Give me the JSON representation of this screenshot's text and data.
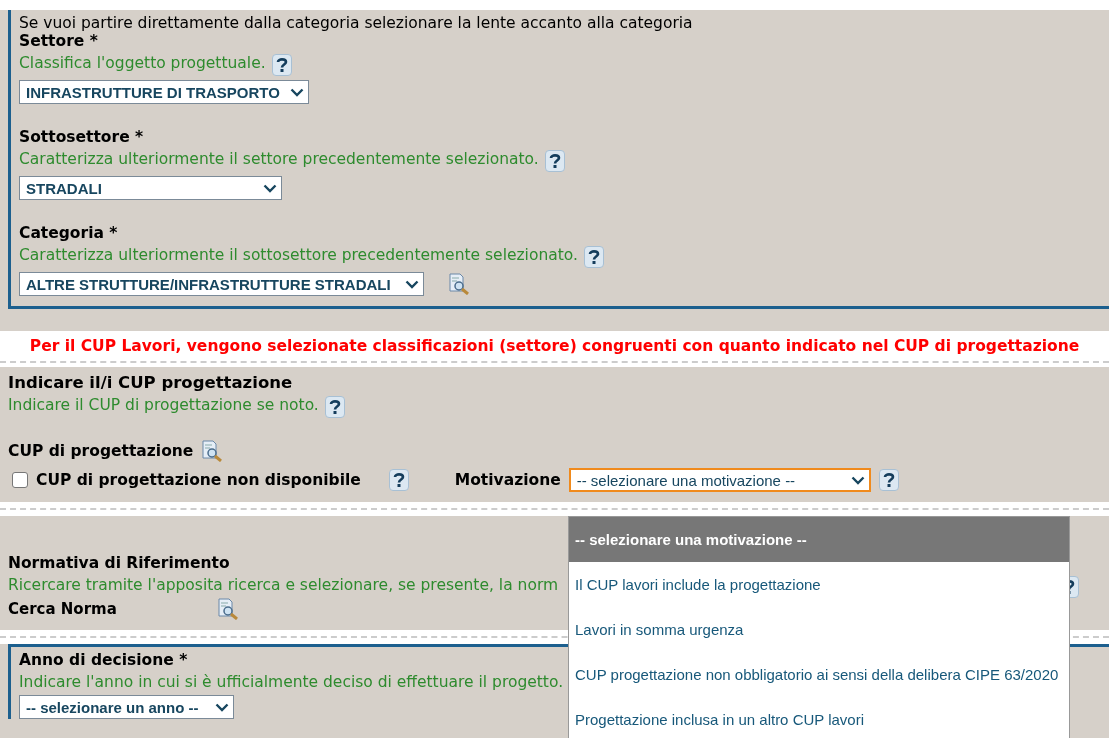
{
  "intro": "Se vuoi partire direttamente dalla categoria selezionare la lente accanto alla categoria",
  "classification_fields": [
    {
      "label": "Settore *",
      "hint": "Classifica l'oggetto progettuale.",
      "value": "INFRASTRUTTURE DI TRASPORTO",
      "search_icon": false
    },
    {
      "label": "Sottosettore *",
      "hint": "Caratterizza ulteriormente il settore precedentemente selezionato.",
      "value": "STRADALI",
      "search_icon": false
    },
    {
      "label": "Categoria *",
      "hint": "Caratterizza ulteriormente il sottosettore precedentemente selezionato.",
      "value": "ALTRE STRUTTURE/INFRASTRUTTURE STRADALI",
      "search_icon": true
    }
  ],
  "warning": "Per il CUP Lavori, vengono selezionate classificazioni (settore) congruenti con quanto indicato nel CUP di progettazione",
  "cup_section": {
    "heading": "Indicare il/i CUP progettazione",
    "hint": "Indicare il CUP di progettazione se noto.",
    "cup_label": "CUP di progettazione",
    "not_available": {
      "label": "CUP di progettazione non disponibile",
      "checked": false
    },
    "motivation": {
      "label": "Motivazione",
      "value": "-- selezionare una motivazione --",
      "expanded": true,
      "options": [
        {
          "label": "-- selezionare una motivazione --",
          "selected": true
        },
        {
          "label": "Il CUP lavori include la progettazione",
          "selected": false
        },
        {
          "label": "Lavori in somma urgenza",
          "selected": false
        },
        {
          "label": "CUP progettazione non obbligatorio ai sensi della delibera CIPE 63/2020",
          "selected": false
        },
        {
          "label": "Progettazione inclusa in un altro CUP lavori",
          "selected": false
        }
      ]
    }
  },
  "norm_section": {
    "heading": "Normativa di Riferimento",
    "hint": "Ricercare tramite l'apposita ricerca e selezionare, se presente, la norm",
    "search_label": "Cerca Norma"
  },
  "year_section": {
    "heading": "Anno di decisione *",
    "hint": "Indicare l'anno in cui si è ufficialmente deciso di effettuare il progetto.",
    "value": "-- selezionare un anno --"
  }
}
